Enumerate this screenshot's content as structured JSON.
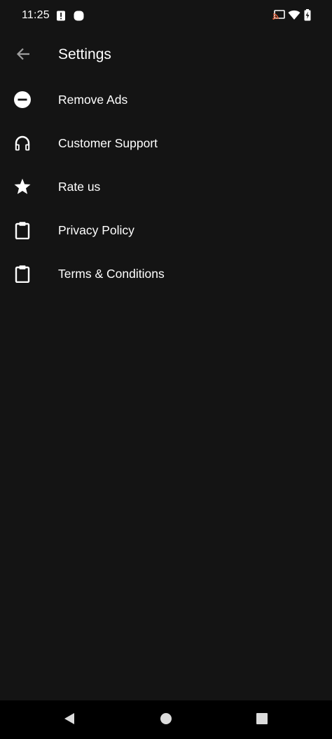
{
  "status_bar": {
    "time": "11:25",
    "icons": [
      "alert-icon",
      "notification-dot-icon",
      "cast-icon",
      "wifi-icon",
      "battery-charging-icon"
    ]
  },
  "app_bar": {
    "back_icon": "arrow-back-icon",
    "title": "Settings"
  },
  "menu": {
    "items": [
      {
        "label": "Remove Ads",
        "icon": "minus-circle-icon"
      },
      {
        "label": "Customer Support",
        "icon": "headphones-icon"
      },
      {
        "label": "Rate us",
        "icon": "star-icon"
      },
      {
        "label": "Privacy Policy",
        "icon": "clipboard-icon"
      },
      {
        "label": "Terms & Conditions",
        "icon": "clipboard-icon"
      }
    ]
  },
  "nav_bar": {
    "icons": [
      "back-triangle-icon",
      "home-circle-icon",
      "recents-square-icon"
    ]
  },
  "colors": {
    "background": "#141414",
    "text": "#ffffff",
    "nav_background": "#000000",
    "cast_accent": "#e0603a"
  }
}
